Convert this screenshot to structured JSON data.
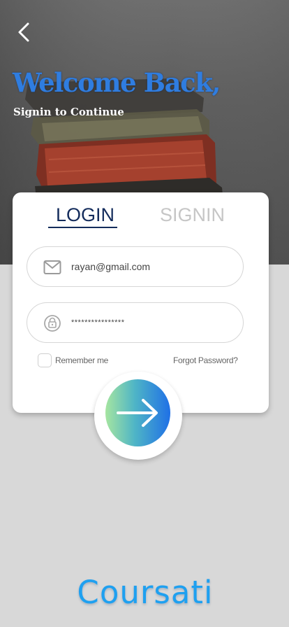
{
  "header": {
    "title": "Welcome Back,",
    "subtitle": "Signin to Continue",
    "back_icon": "chevron-left-icon"
  },
  "tabs": [
    {
      "label": "LOGIN",
      "active": true
    },
    {
      "label": "SIGNIN",
      "active": false
    }
  ],
  "form": {
    "email": {
      "value": "rayan@gmail.com",
      "icon": "mail-icon"
    },
    "password": {
      "value": "****************",
      "icon": "lock-icon"
    },
    "remember_label": "Remember me",
    "remember_checked": false,
    "forgot_label": "Forgot Password?",
    "submit_icon": "arrow-right-icon"
  },
  "brand": {
    "name": "Coursati"
  },
  "colors": {
    "title_blue": "#2f7de0",
    "tab_active": "#142c5c",
    "tab_inactive": "#c6c6c6",
    "gradient_start": "#a6e5a0",
    "gradient_end": "#1f70e6",
    "brand": "#1ea0f0",
    "background": "#d8d8d8"
  }
}
